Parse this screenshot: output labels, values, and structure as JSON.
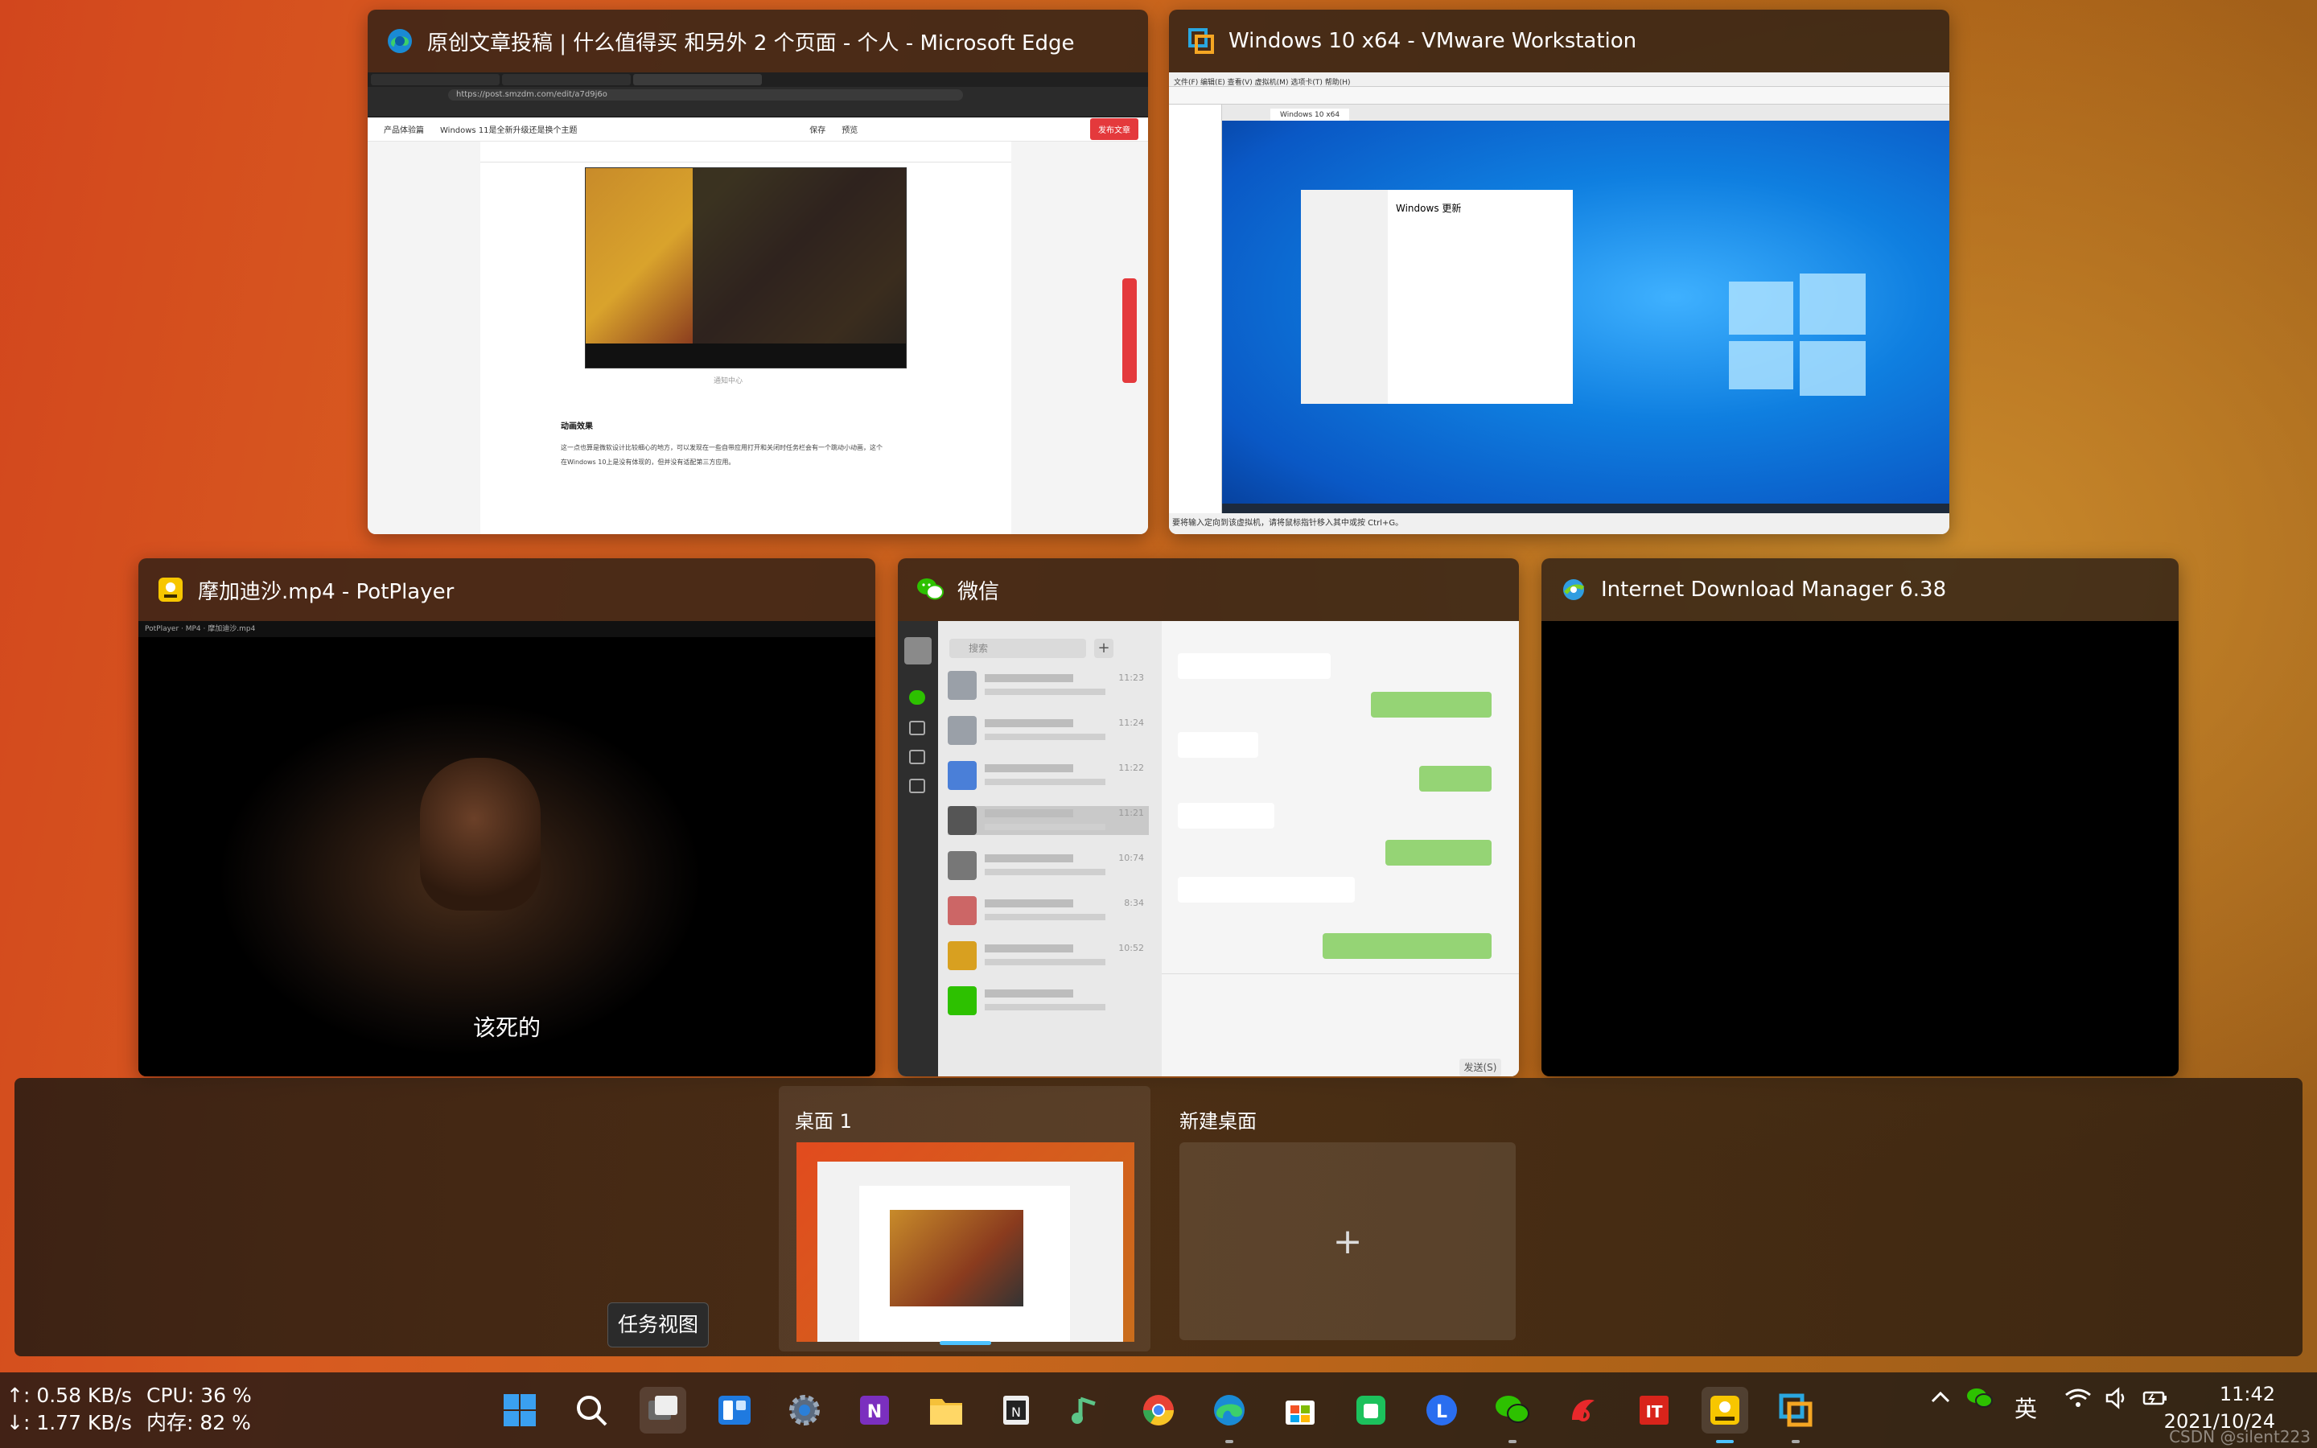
{
  "windows": {
    "edge": {
      "title": "原创文章投稿 | 什么值得买 和另外 2 个页面 - 个人 - Microsoft Edge",
      "url": "https://post.smzdm.com/edit/a7d9j6o",
      "toolbar_left": "产品体验篇",
      "article_title": "Windows 11是全新升级还是换个主题",
      "save": "保存",
      "preview": "预览",
      "publish": "发布文章",
      "heading": "动画效果",
      "para1": "这一点也算是微软设计比较细心的地方，可以发现在一些自带应用打开和关闭时任务栏会有一个跳动小动画，这个",
      "para2": "在Windows 10上是没有体现的，但并没有适配第三方应用。",
      "caption": "通知中心"
    },
    "vmware": {
      "title": "Windows 10 x64 - VMware Workstation",
      "menu": "文件(F)  编辑(E)  查看(V)  虚拟机(M)  选项卡(T)  帮助(H)",
      "tab": "Windows 10 x64",
      "settings_title": "Windows 更新",
      "status": "要将输入定向到该虚拟机，请将鼠标指针移入其中或按 Ctrl+G。"
    },
    "potplayer": {
      "title": "摩加迪沙.mp4 - PotPlayer",
      "bar": "PotPlayer  ·  MP4  ·  摩加迪沙.mp4",
      "subtitle": "该死的"
    },
    "wechat": {
      "title": "微信",
      "search_placeholder": "搜索",
      "send": "发送(S)",
      "times": [
        "11:23",
        "11:24",
        "11:22",
        "11:21",
        "10:74",
        "8:34",
        "10:52"
      ]
    },
    "idm": {
      "title": "Internet Download Manager 6.38"
    }
  },
  "desktops": {
    "desktop1": "桌面 1",
    "new_desktop": "新建桌面",
    "plus": "+"
  },
  "tooltip": "任务视图",
  "status": {
    "upload": "↑: 0.58 KB/s",
    "download": "↓: 1.77 KB/s",
    "cpu": "CPU: 36 %",
    "memory": "内存: 82 %"
  },
  "tray": {
    "ime": "英",
    "time": "11:42",
    "date": "2021/10/24"
  },
  "taskbar_icons": [
    "start-icon",
    "search-icon",
    "task-view-icon",
    "widgets-icon",
    "settings-icon",
    "onenote-icon",
    "file-explorer-icon",
    "notepad-icon",
    "music-icon",
    "chrome-icon",
    "edge-icon",
    "store-icon",
    "app-icon",
    "lark-icon",
    "wechat-icon",
    "app-red-icon",
    "ithome-icon",
    "potplayer-icon",
    "vmware-icon"
  ],
  "watermark": "CSDN @silent223"
}
